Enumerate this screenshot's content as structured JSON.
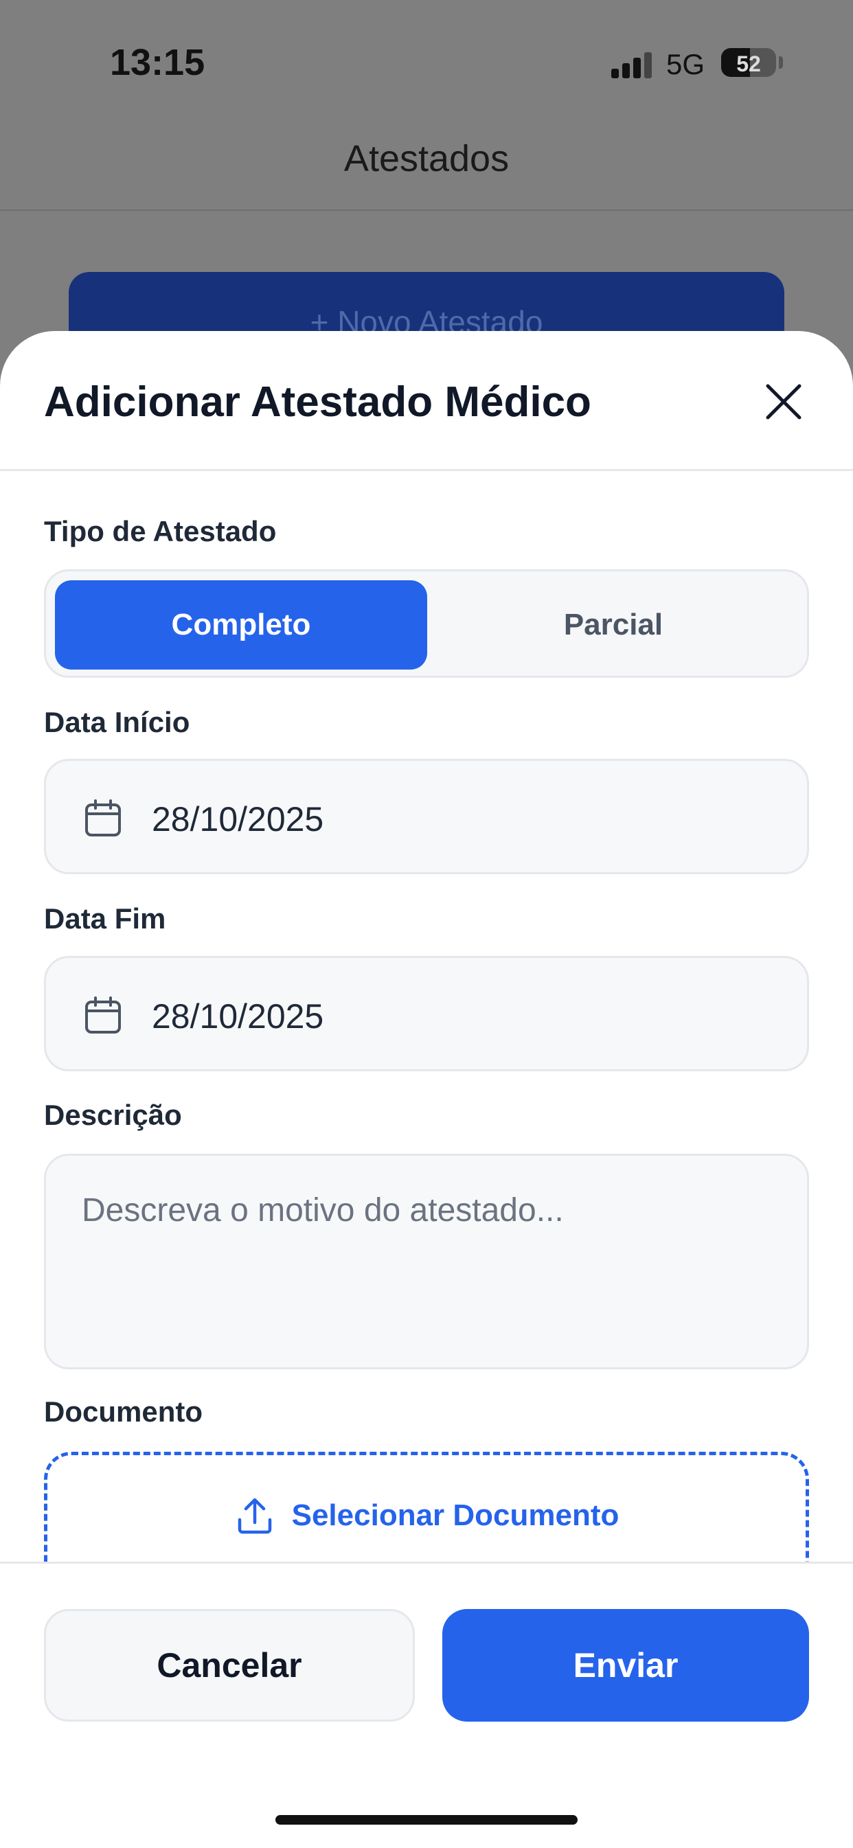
{
  "status_bar": {
    "time": "13:15",
    "network": "5G",
    "battery": "52"
  },
  "background": {
    "header_title": "Atestados",
    "new_button_label": "+ Novo Atestado"
  },
  "sheet": {
    "title": "Adicionar Atestado Médico",
    "type_label": "Tipo de Atestado",
    "type_options": [
      "Completo",
      "Parcial"
    ],
    "type_selected": "Completo",
    "start_label": "Data Início",
    "start_value": "28/10/2025",
    "end_label": "Data Fim",
    "end_value": "28/10/2025",
    "description_label": "Descrição",
    "description_placeholder": "Descreva o motivo do atestado...",
    "document_label": "Documento",
    "document_button": "Selecionar Documento"
  },
  "footer": {
    "cancel_label": "Cancelar",
    "submit_label": "Enviar"
  },
  "colors": {
    "primary": "#2563eb",
    "overlay": "#7f7f7f"
  },
  "icons": [
    "close-icon",
    "calendar-icon",
    "upload-icon",
    "signal-icon",
    "battery-icon"
  ]
}
